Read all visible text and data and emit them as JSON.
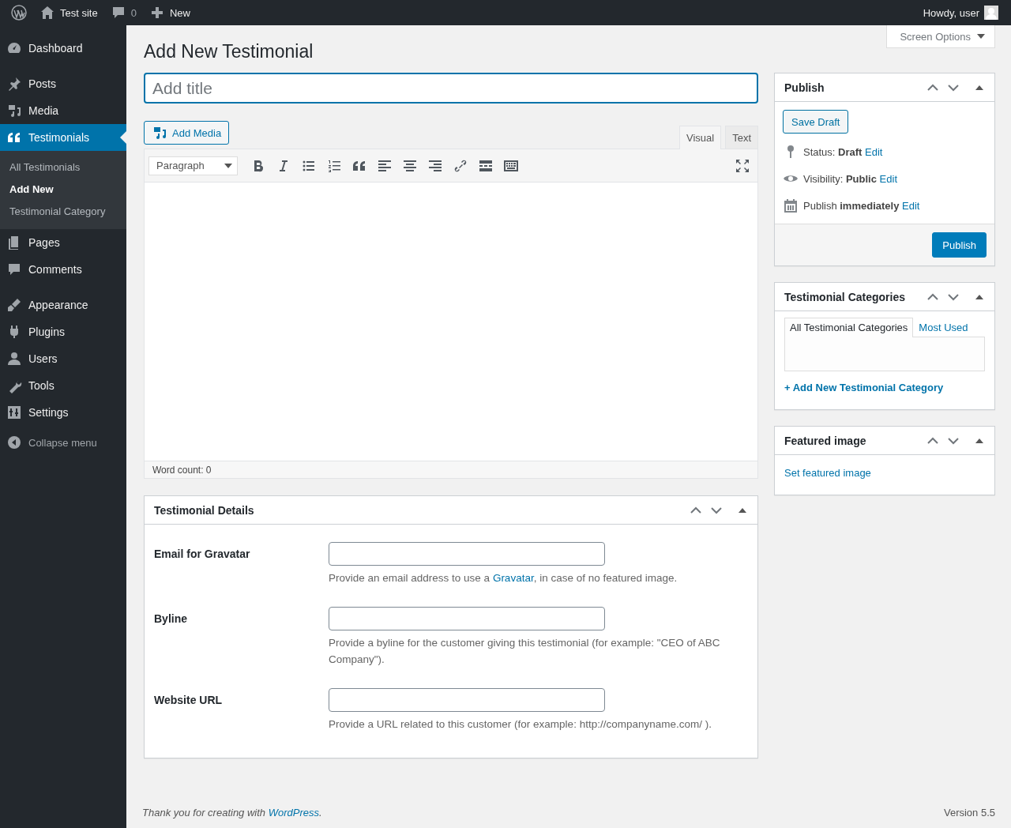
{
  "admin_bar": {
    "site": "Test site",
    "comments": "0",
    "new": "New",
    "howdy": "Howdy, user"
  },
  "sidebar": {
    "menu_groups": [
      [
        {
          "label": "Dashboard",
          "selected": false
        }
      ],
      [
        {
          "label": "Posts",
          "selected": false
        },
        {
          "label": "Media",
          "selected": false
        },
        {
          "label": "Testimonials",
          "selected": true,
          "children": [
            {
              "label": "All Testimonials",
              "selected": false
            },
            {
              "label": "Add New",
              "selected": true
            },
            {
              "label": "Testimonial Category",
              "selected": false
            }
          ]
        },
        {
          "label": "Pages",
          "selected": false
        },
        {
          "label": "Comments",
          "selected": false
        }
      ],
      [
        {
          "label": "Appearance",
          "selected": false
        },
        {
          "label": "Plugins",
          "selected": false
        },
        {
          "label": "Users",
          "selected": false
        },
        {
          "label": "Tools",
          "selected": false
        },
        {
          "label": "Settings",
          "selected": false
        }
      ]
    ],
    "collapse": "Collapse menu"
  },
  "screen_options": "Screen Options",
  "page_title": "Add New Testimonial",
  "title_field": {
    "placeholder": "Add title"
  },
  "editor": {
    "add_media": "Add Media",
    "tabs": [
      {
        "label": "Visual",
        "selected": true
      },
      {
        "label": "Text",
        "selected": false
      }
    ],
    "format_select": "Paragraph",
    "word_count": "Word count: 0"
  },
  "details_box": {
    "title": "Testimonial Details",
    "fields": [
      {
        "label": "Email for Gravatar",
        "description": {
          "before": "Provide an email address to use a ",
          "link": "Gravatar",
          "after": ", in case of no featured image."
        }
      },
      {
        "label": "Byline",
        "description": {
          "before": "Provide a byline for the customer giving this testimonial (for example: \"CEO of ABC Company\")."
        }
      },
      {
        "label": "Website URL",
        "description": {
          "before": "Provide a URL related to this customer (for example: http://companyname.com/ )."
        }
      }
    ]
  },
  "publish_box": {
    "title": "Publish",
    "save_draft": "Save Draft",
    "rows": [
      {
        "text": "Status: **Draft**",
        "link": "Edit"
      },
      {
        "text": "Visibility: **Public**",
        "link": "Edit"
      },
      {
        "text": "Publish **immediately**",
        "link": "Edit"
      }
    ],
    "publish": "Publish"
  },
  "categories_box": {
    "title": "Testimonial Categories",
    "tabs": [
      {
        "label": "All Testimonial Categories",
        "selected": true
      },
      {
        "label": "Most Used",
        "selected": false
      }
    ],
    "add_link": "+ Add New Testimonial Category"
  },
  "featured_box": {
    "title": "Featured image",
    "link": "Set featured image"
  },
  "footer": {
    "before": "Thank you for creating with ",
    "link": "WordPress",
    "after": ".",
    "version": "Version 5.5"
  }
}
